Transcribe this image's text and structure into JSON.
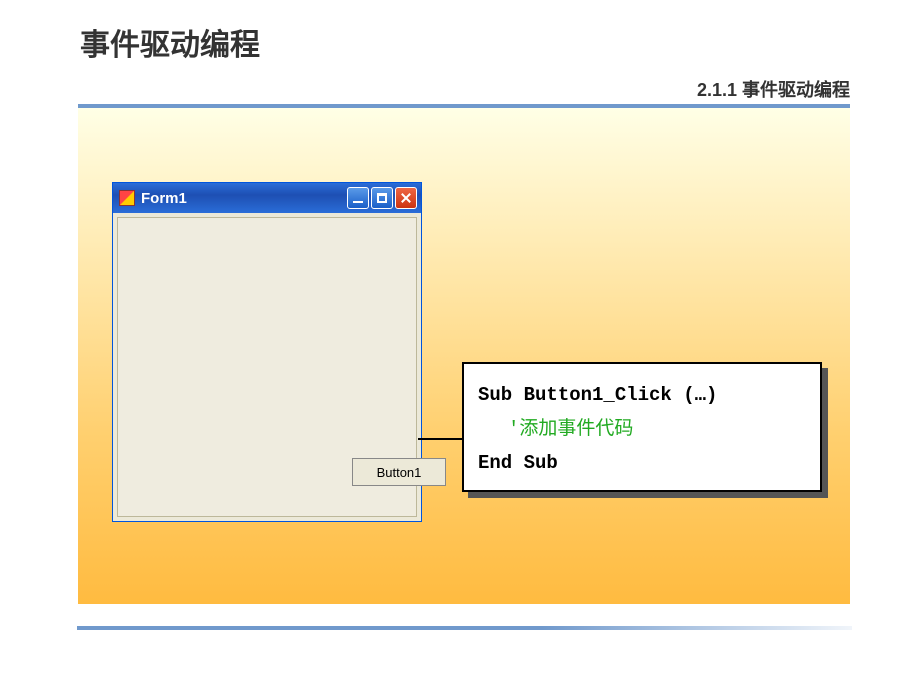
{
  "slide": {
    "title": "事件驱动编程",
    "subtitle": "2.1.1 事件驱动编程"
  },
  "form": {
    "title": "Form1",
    "button_label": "Button1"
  },
  "code": {
    "line1": "Sub Button1_Click (…)",
    "comment": "'添加事件代码",
    "line3": "End Sub"
  }
}
